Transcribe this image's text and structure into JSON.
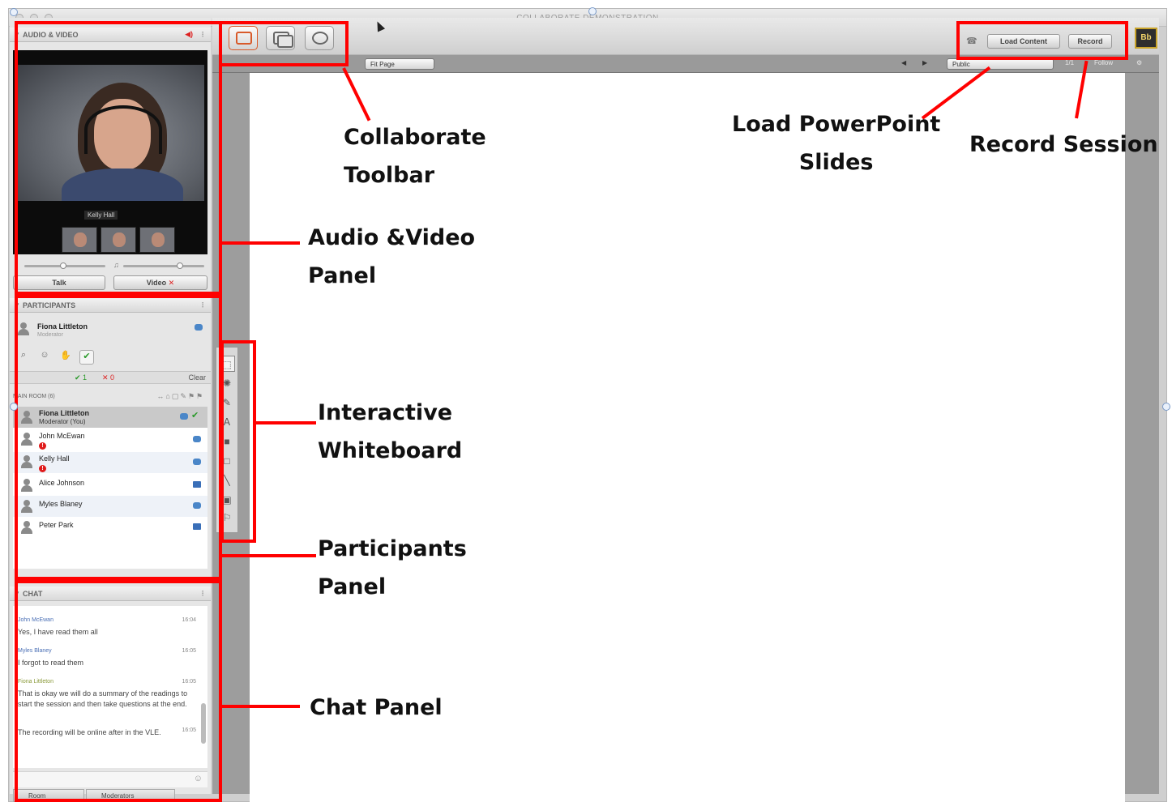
{
  "window": {
    "title": "COLLABORATE DEMONSTRATION"
  },
  "audio_video": {
    "header": "AUDIO & VIDEO",
    "camera_name": "Kelly Hall",
    "talk_button": "Talk",
    "video_button": "Video"
  },
  "participants": {
    "header": "PARTICIPANTS",
    "self": {
      "name": "Fiona Littleton",
      "role": "Moderator"
    },
    "counts": {
      "yes": "1",
      "no": "0",
      "clear": "Clear"
    },
    "room_label": "MAIN ROOM (6)",
    "list": [
      {
        "name": "Fiona Littleton",
        "role": "Moderator (You)"
      },
      {
        "name": "John McEwan",
        "role": ""
      },
      {
        "name": "Kelly Hall",
        "role": ""
      },
      {
        "name": "Alice Johnson",
        "role": ""
      },
      {
        "name": "Myles Blaney",
        "role": ""
      },
      {
        "name": "Peter Park",
        "role": ""
      }
    ]
  },
  "chat": {
    "header": "CHAT",
    "messages": [
      {
        "author": "John McEwan",
        "time": "16:04",
        "text": "Yes, I have read them all"
      },
      {
        "author": "Myles Blaney",
        "time": "16:05",
        "text": "I forgot to read them"
      },
      {
        "author": "Fiona Littleton",
        "time": "16:05",
        "text": "That is okay we will do a summary of the readings to start the session and then take questions at the end."
      },
      {
        "author": "",
        "time": "16:05",
        "text": "The recording will be online after in the VLE."
      }
    ],
    "tabs": [
      "Room",
      "Moderators"
    ]
  },
  "toolbar": {
    "load_content": "Load Content",
    "record": "Record",
    "logo": "Bb"
  },
  "subbar": {
    "fit_page": "Fit Page",
    "public": "Public",
    "page": "1/1",
    "follow": "Follow"
  },
  "icons": {
    "wb_tools": [
      "select-icon",
      "pointer-icon",
      "pen-icon",
      "text-icon",
      "filled-rect-icon",
      "rect-icon",
      "line-icon",
      "image-icon",
      "clipart-icon"
    ]
  },
  "annotations": {
    "collaborate_toolbar": [
      "Collaborate",
      "Toolbar"
    ],
    "load_powerpoint": [
      "Load PowerPoint",
      "Slides"
    ],
    "record_session": [
      "Record Session"
    ],
    "audio_video_panel": [
      "Audio &Video",
      "Panel"
    ],
    "interactive_whiteboard": [
      "Interactive",
      "Whiteboard"
    ],
    "participants_panel": [
      "Participants",
      "Panel"
    ],
    "chat_panel": [
      "Chat Panel"
    ]
  },
  "colors": {
    "annotation": "#ff0000",
    "accent": "#4a86c8"
  }
}
